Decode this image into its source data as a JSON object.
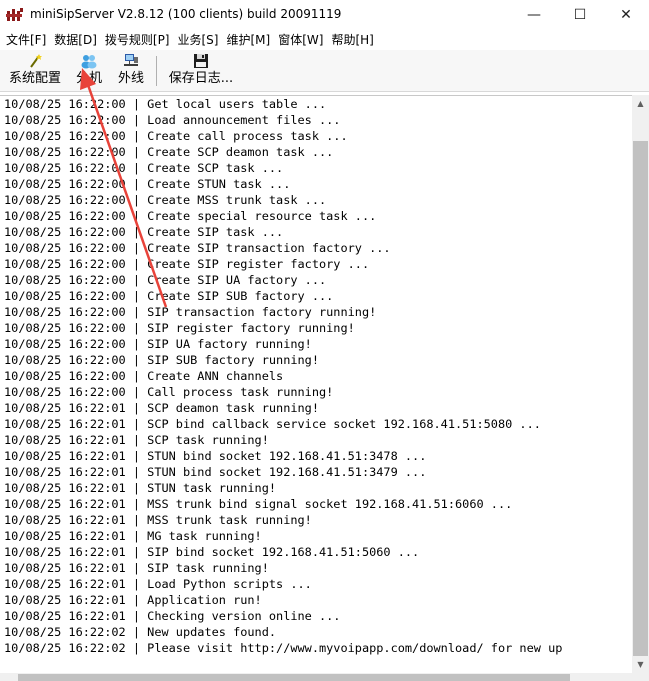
{
  "window": {
    "title": "miniSipServer V2.8.12 (100 clients) build 20091119",
    "minimize_glyph": "—",
    "maximize_glyph": "☐",
    "close_glyph": "✕"
  },
  "menu": [
    "文件[F]",
    "数据[D]",
    "拨号规则[P]",
    "业务[S]",
    "维护[M]",
    "窗体[W]",
    "帮助[H]"
  ],
  "toolbar": {
    "items": [
      {
        "label": "系统配置",
        "icon": "wand-icon"
      },
      {
        "label": "分机",
        "icon": "users-icon"
      },
      {
        "label": "外线",
        "icon": "network-icon"
      },
      {
        "label": "保存日志...",
        "icon": "floppy-disk-icon"
      }
    ]
  },
  "log": [
    "10/08/25 16:22:00 | Get local users table ...",
    "10/08/25 16:22:00 | Load announcement files ...",
    "10/08/25 16:22:00 | Create call process task ...",
    "10/08/25 16:22:00 | Create SCP deamon task ...",
    "10/08/25 16:22:00 | Create SCP task ...",
    "10/08/25 16:22:00 | Create STUN task ...",
    "10/08/25 16:22:00 | Create MSS trunk task ...",
    "10/08/25 16:22:00 | Create special resource task ...",
    "10/08/25 16:22:00 | Create SIP task ...",
    "10/08/25 16:22:00 | Create SIP transaction factory ...",
    "10/08/25 16:22:00 | Create SIP register factory ...",
    "10/08/25 16:22:00 | Create SIP UA factory ...",
    "10/08/25 16:22:00 | Create SIP SUB factory ...",
    "10/08/25 16:22:00 | SIP transaction factory running!",
    "10/08/25 16:22:00 | SIP register factory running!",
    "10/08/25 16:22:00 | SIP UA factory running!",
    "10/08/25 16:22:00 | SIP SUB factory running!",
    "10/08/25 16:22:00 | Create ANN channels",
    "10/08/25 16:22:00 | Call process task running!",
    "10/08/25 16:22:01 | SCP deamon task running!",
    "10/08/25 16:22:01 | SCP bind callback service socket 192.168.41.51:5080 ...",
    "10/08/25 16:22:01 | SCP task running!",
    "10/08/25 16:22:01 | STUN bind socket 192.168.41.51:3478 ...",
    "10/08/25 16:22:01 | STUN bind socket 192.168.41.51:3479 ...",
    "10/08/25 16:22:01 | STUN task running!",
    "10/08/25 16:22:01 | MSS trunk bind signal socket 192.168.41.51:6060 ...",
    "10/08/25 16:22:01 | MSS trunk task running!",
    "10/08/25 16:22:01 | MG task running!",
    "10/08/25 16:22:01 | SIP bind socket 192.168.41.51:5060 ...",
    "10/08/25 16:22:01 | SIP task running!",
    "10/08/25 16:22:01 | Load Python scripts ...",
    "10/08/25 16:22:01 | Application run!",
    "10/08/25 16:22:01 | Checking version online ...",
    "10/08/25 16:22:02 | New updates found.",
    "10/08/25 16:22:02 | Please visit http://www.myvoipapp.com/download/ for new up"
  ],
  "colors": {
    "annotation_arrow": "#e8433a"
  }
}
